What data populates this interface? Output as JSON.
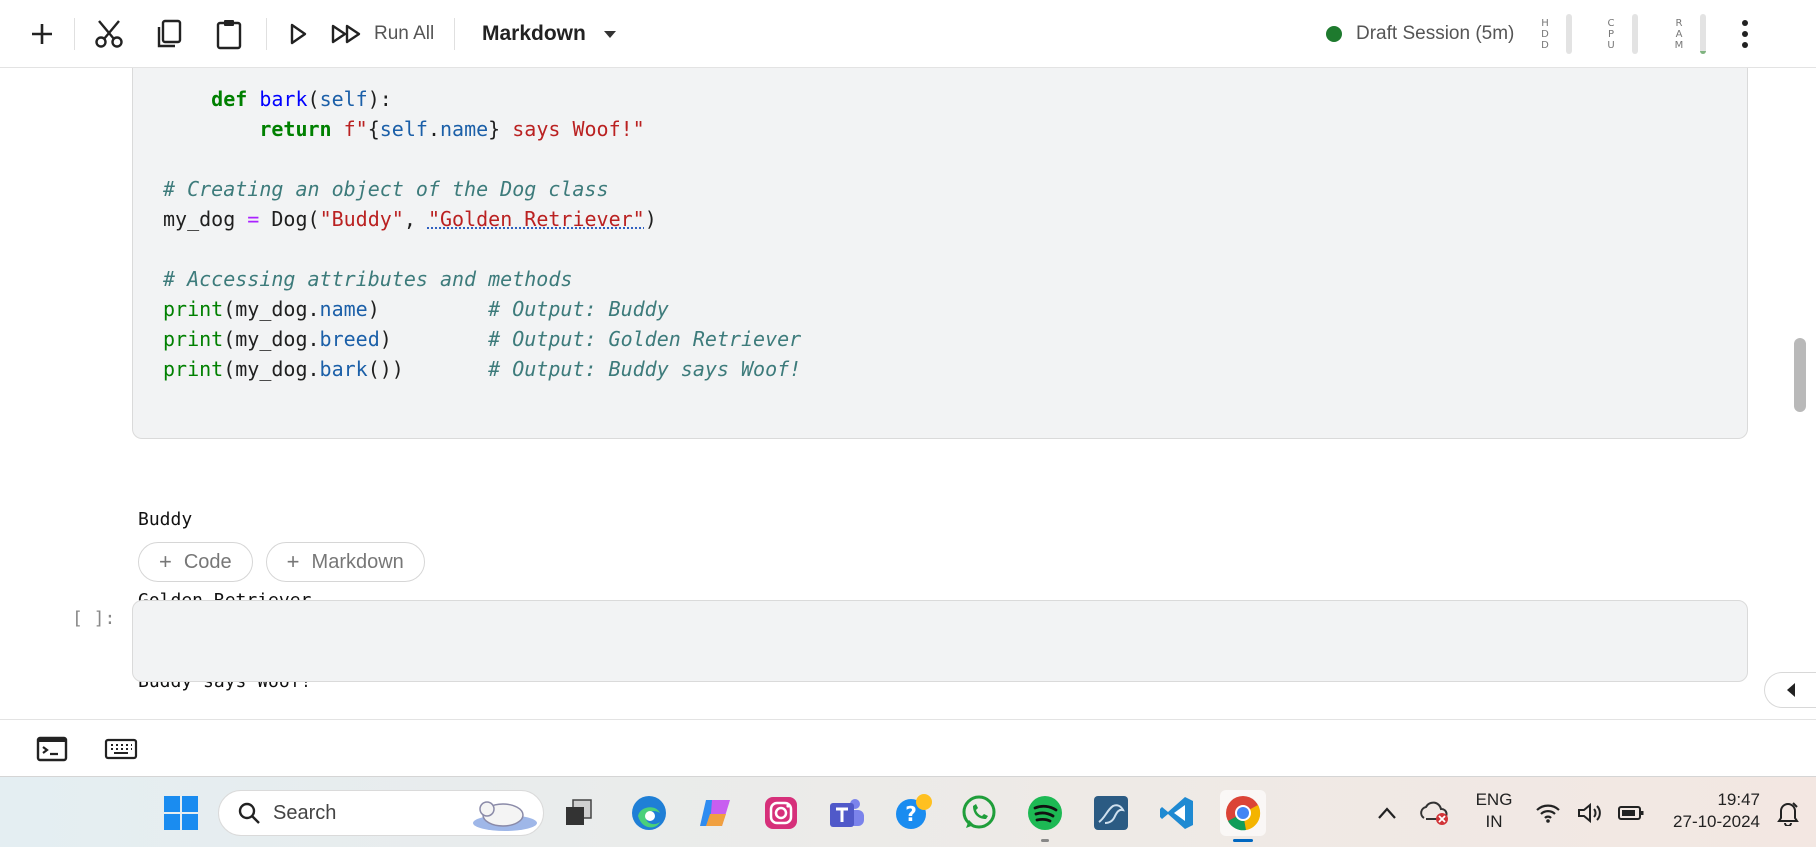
{
  "toolbar": {
    "run_all_label": "Run All",
    "cell_type": "Markdown",
    "session_label": "Draft Session (5m)",
    "session_status_color": "#1e7a2e",
    "meters": [
      {
        "label": [
          "H",
          "D",
          "D"
        ]
      },
      {
        "label": [
          "C",
          "P",
          "U"
        ]
      },
      {
        "label": [
          "R",
          "A",
          "M"
        ]
      }
    ],
    "icons": [
      "add-icon",
      "cut-icon",
      "copy-icon",
      "paste-icon",
      "run-icon",
      "run-all-icon",
      "more-icon"
    ]
  },
  "code": {
    "lines": [
      "    def bark(self):",
      "        return f\"{self.name} says Woof!\"",
      "",
      "# Creating an object of the Dog class",
      "my_dog = Dog(\"Buddy\", \"Golden Retriever\")",
      "",
      "# Accessing attributes and methods",
      "print(my_dog.name)         # Output: Buddy",
      "print(my_dog.breed)        # Output: Golden Retriever",
      "print(my_dog.bark())       # Output: Buddy says Woof!"
    ]
  },
  "output": {
    "lines": [
      "Buddy",
      "Golden Retriever",
      "Buddy says Woof!"
    ]
  },
  "add_cell": {
    "code_label": "Code",
    "markdown_label": "Markdown"
  },
  "empty_cell": {
    "prompt": "[ ]:"
  },
  "taskbar": {
    "search_placeholder": "Search",
    "language": "ENG",
    "region": "IN",
    "time": "19:47",
    "date": "27-10-2024",
    "apps": [
      "start-icon",
      "task-view-icon",
      "edge-icon",
      "copilot-icon",
      "instagram-icon",
      "teams-icon",
      "help-icon",
      "whatsapp-icon",
      "spotify-icon",
      "mysql-workbench-icon",
      "vscode-icon",
      "chrome-icon"
    ]
  }
}
